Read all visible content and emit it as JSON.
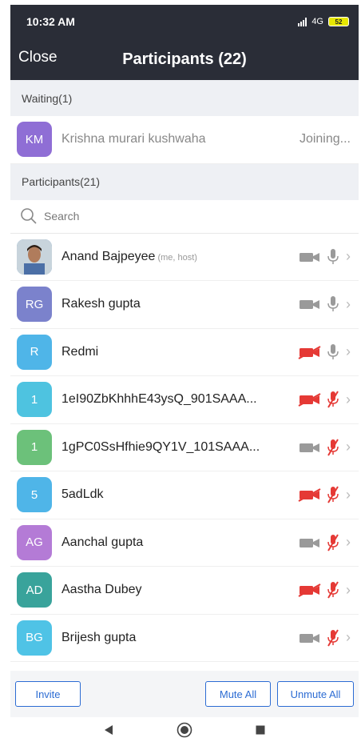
{
  "status": {
    "time": "10:32 AM",
    "network": "4G",
    "battery": "52"
  },
  "nav": {
    "close_label": "Close",
    "title": "Participants (22)"
  },
  "waiting": {
    "header": "Waiting(1)",
    "item": {
      "initials": "KM",
      "name": "Krishna murari kushwaha",
      "status": "Joining...",
      "color": "#8f6ed5"
    }
  },
  "participants_header": "Participants(21)",
  "search": {
    "placeholder": "Search"
  },
  "participants": [
    {
      "initials": "",
      "photo": true,
      "name": "Anand Bajpeyee",
      "tag": "(me, host)",
      "color": "#5a8fc9",
      "video": "on",
      "mic": "on"
    },
    {
      "initials": "RG",
      "name": "Rakesh gupta",
      "tag": "",
      "color": "#7b82cc",
      "video": "on",
      "mic": "on"
    },
    {
      "initials": "R",
      "name": "Redmi",
      "tag": "",
      "color": "#4fb5e8",
      "video": "off",
      "mic": "on"
    },
    {
      "initials": "1",
      "name": "1eI90ZbKhhhE43ysQ_901SAAA...",
      "tag": "",
      "color": "#4ec3e0",
      "video": "off",
      "mic": "off"
    },
    {
      "initials": "1",
      "name": "1gPC0SsHfhie9QY1V_101SAAA...",
      "tag": "",
      "color": "#6cc17a",
      "video": "on",
      "mic": "off"
    },
    {
      "initials": "5",
      "name": "5adLdk",
      "tag": "",
      "color": "#4fb5e8",
      "video": "off",
      "mic": "off"
    },
    {
      "initials": "AG",
      "name": "Aanchal gupta",
      "tag": "",
      "color": "#b47bd6",
      "video": "on",
      "mic": "off"
    },
    {
      "initials": "AD",
      "name": "Aastha Dubey",
      "tag": "",
      "color": "#39a39b",
      "video": "off",
      "mic": "off"
    },
    {
      "initials": "BG",
      "name": "Brijesh gupta",
      "tag": "",
      "color": "#4fc3e6",
      "video": "on",
      "mic": "off"
    }
  ],
  "buttons": {
    "invite": "Invite",
    "mute_all": "Mute All",
    "unmute_all": "Unmute All"
  },
  "colors": {
    "accent": "#2c6cd3",
    "muted_red": "#e53935",
    "icon_gray": "#9a9a9a",
    "topbar": "#2a2d37"
  },
  "icons": {
    "camera": "camera-icon",
    "mic": "mic-icon",
    "chevron": "chevron-right-icon",
    "search": "search-icon"
  }
}
